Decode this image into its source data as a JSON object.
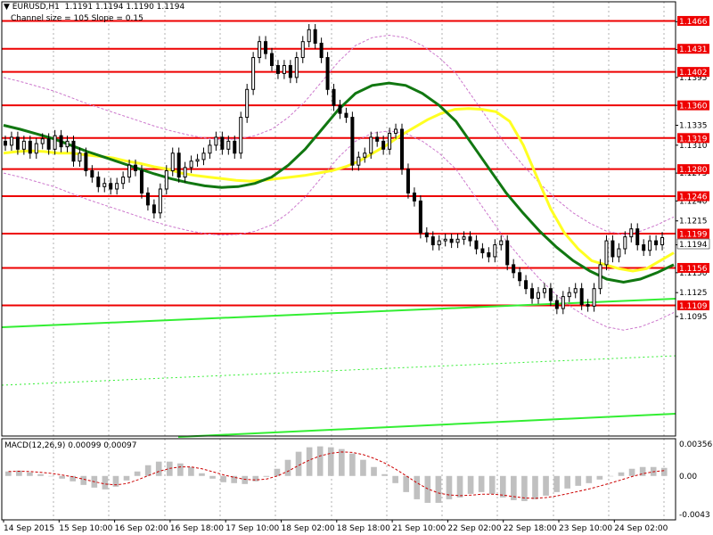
{
  "header": {
    "symbol_line": "EURUSD,H1  1.1191 1.1194 1.1190 1.1194",
    "indicator_line": "Channel size = 105 Slope = 0.15",
    "macd_label": "MACD(12,26,9) 0.00099 0.00097"
  },
  "colors": {
    "level": "#ee0000",
    "channel": "#33ee33",
    "ma_slow": "#ffff22",
    "ma_fast": "#117711",
    "envelope": "#cc77cc",
    "candle": "#000000",
    "macd_hist": "#c0c0c0",
    "macd_signal": "#cc0000"
  },
  "chart_data": {
    "type": "candlestick",
    "symbol": "EURUSD",
    "timeframe": "H1",
    "ylim": [
      1.0945,
      1.149
    ],
    "price_ticks": [
      "1.1465",
      "1.1430",
      "1.1395",
      "1.1360",
      "1.1335",
      "1.1310",
      "1.1275",
      "1.1240",
      "1.1215",
      "1.1185",
      "1.1150",
      "1.1125",
      "1.1095"
    ],
    "x_labels": [
      "14 Sep 2015",
      "15 Sep 10:00",
      "16 Sep 02:00",
      "16 Sep 18:00",
      "17 Sep 10:00",
      "18 Sep 02:00",
      "18 Sep 18:00",
      "21 Sep 10:00",
      "22 Sep 02:00",
      "22 Sep 18:00",
      "23 Sep 10:00",
      "24 Sep 02:00"
    ],
    "levels": [
      "1.1466",
      "1.1431",
      "1.1402",
      "1.1360",
      "1.1319",
      "1.1280",
      "1.1246",
      "1.1199",
      "1.1156",
      "1.1109"
    ],
    "current_price": "1.1194",
    "closes": [
      1.131,
      1.132,
      1.1305,
      1.1315,
      1.13,
      1.1312,
      1.1318,
      1.1305,
      1.1322,
      1.1308,
      1.1315,
      1.129,
      1.13,
      1.1278,
      1.127,
      1.1258,
      1.1262,
      1.1255,
      1.1262,
      1.127,
      1.1285,
      1.1278,
      1.125,
      1.1235,
      1.1225,
      1.1255,
      1.1278,
      1.13,
      1.127,
      1.1282,
      1.129,
      1.1292,
      1.13,
      1.131,
      1.132,
      1.1305,
      1.1315,
      1.13,
      1.1345,
      1.138,
      1.142,
      1.144,
      1.1425,
      1.141,
      1.14,
      1.141,
      1.1395,
      1.142,
      1.144,
      1.1455,
      1.1438,
      1.142,
      1.138,
      1.136,
      1.135,
      1.1345,
      1.1285,
      1.1295,
      1.13,
      1.132,
      1.1315,
      1.1305,
      1.1325,
      1.133,
      1.128,
      1.125,
      1.124,
      1.12,
      1.1195,
      1.1185,
      1.119,
      1.1192,
      1.1188,
      1.1192,
      1.1195,
      1.119,
      1.118,
      1.1175,
      1.117,
      1.1185,
      1.119,
      1.116,
      1.115,
      1.114,
      1.113,
      1.1118,
      1.1125,
      1.113,
      1.1115,
      1.1105,
      1.112,
      1.1125,
      1.113,
      1.111,
      1.1108,
      1.113,
      1.116,
      1.119,
      1.117,
      1.118,
      1.1195,
      1.1205,
      1.1185,
      1.1178,
      1.119,
      1.1185,
      1.1194
    ],
    "ma_slow": [
      1.13,
      1.1302,
      1.1303,
      1.1302,
      1.13,
      1.13,
      1.1298,
      1.1296,
      1.1294,
      1.129,
      1.1287,
      1.1283,
      1.128,
      1.1275,
      1.1272,
      1.127,
      1.1268,
      1.1266,
      1.1265,
      1.1266,
      1.1268,
      1.127,
      1.1272,
      1.1275,
      1.1278,
      1.1283,
      1.129,
      1.13,
      1.131,
      1.1322,
      1.1332,
      1.1342,
      1.135,
      1.1355,
      1.1356,
      1.1355,
      1.1352,
      1.134,
      1.131,
      1.127,
      1.123,
      1.12,
      1.118,
      1.1165,
      1.116,
      1.1155,
      1.1152,
      1.1155,
      1.1165,
      1.1175
    ],
    "ma_fast": [
      1.1335,
      1.133,
      1.1324,
      1.1318,
      1.131,
      1.1302,
      1.1295,
      1.1288,
      1.1281,
      1.1274,
      1.1268,
      1.1263,
      1.1259,
      1.1257,
      1.1258,
      1.1262,
      1.127,
      1.1285,
      1.1305,
      1.133,
      1.1355,
      1.1375,
      1.1385,
      1.1388,
      1.1385,
      1.1375,
      1.136,
      1.134,
      1.131,
      1.128,
      1.125,
      1.1225,
      1.1202,
      1.1182,
      1.1165,
      1.1152,
      1.1142,
      1.1138,
      1.1142,
      1.115,
      1.116
    ],
    "macd_ticks": [
      "0.00356",
      "0.00",
      "-0.0043"
    ],
    "macd_hist": [
      0.0005,
      0.0006,
      0.0004,
      0.0002,
      0.0,
      -0.0003,
      -0.0006,
      -0.001,
      -0.0013,
      -0.0015,
      -0.0012,
      -0.0005,
      0.0005,
      0.0012,
      0.0016,
      0.0016,
      0.0014,
      0.001,
      0.0003,
      -0.0003,
      -0.0007,
      -0.0008,
      -0.0009,
      -0.0006,
      -0.0001,
      0.0008,
      0.0018,
      0.0027,
      0.0032,
      0.0033,
      0.0032,
      0.003,
      0.0025,
      0.0018,
      0.001,
      0.0002,
      -0.0008,
      -0.0018,
      -0.0026,
      -0.003,
      -0.003,
      -0.0026,
      -0.0024,
      -0.002,
      -0.0018,
      -0.002,
      -0.0024,
      -0.0027,
      -0.0028,
      -0.0026,
      -0.0022,
      -0.0018,
      -0.0014,
      -0.0011,
      -0.0008,
      -0.0004,
      0.0,
      0.0004,
      0.0008,
      0.001,
      0.001,
      0.0009
    ]
  }
}
